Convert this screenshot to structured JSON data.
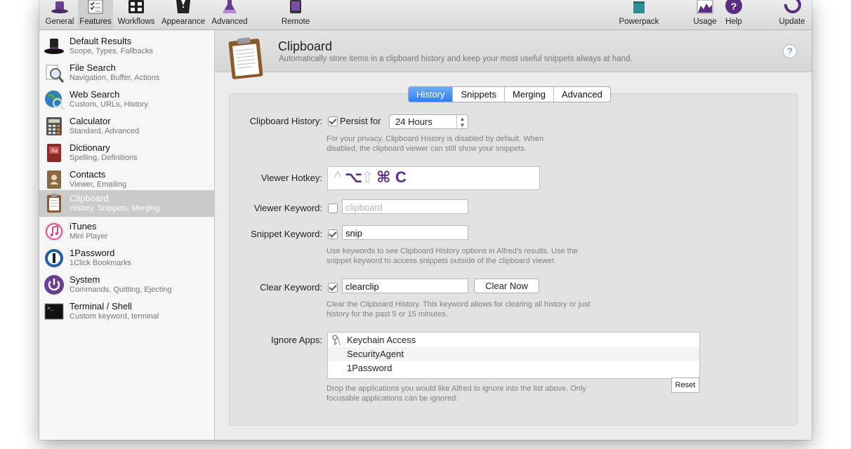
{
  "toolbar": {
    "items": [
      {
        "label": "General",
        "icon": "hat-icon"
      },
      {
        "label": "Features",
        "icon": "checklist-icon"
      },
      {
        "label": "Workflows",
        "icon": "workflows-grid-icon"
      },
      {
        "label": "Appearance",
        "icon": "tuxedo-icon"
      },
      {
        "label": "Advanced",
        "icon": "flask-icon"
      },
      {
        "label": "Remote",
        "icon": "ipad-icon"
      },
      {
        "label": "Powerpack",
        "icon": "powerpack-icon"
      },
      {
        "label": "Usage",
        "icon": "usage-chart-icon"
      },
      {
        "label": "Help",
        "icon": "help-icon"
      },
      {
        "label": "Update",
        "icon": "update-icon"
      }
    ],
    "active": "Features"
  },
  "sidebar": {
    "items": [
      {
        "title": "Default Results",
        "subtitle": "Scope, Types, Fallbacks"
      },
      {
        "title": "File Search",
        "subtitle": "Navigation, Buffer, Actions"
      },
      {
        "title": "Web Search",
        "subtitle": "Custom, URLs, History"
      },
      {
        "title": "Calculator",
        "subtitle": "Standard, Advanced"
      },
      {
        "title": "Dictionary",
        "subtitle": "Spelling, Definitions"
      },
      {
        "title": "Contacts",
        "subtitle": "Viewer, Emailing"
      },
      {
        "title": "Clipboard",
        "subtitle": "History, Snippets, Merging"
      },
      {
        "title": "iTunes",
        "subtitle": "Mini Player"
      },
      {
        "title": "1Password",
        "subtitle": "1Click Bookmarks"
      },
      {
        "title": "System",
        "subtitle": "Commands, Quitting, Ejecting"
      },
      {
        "title": "Terminal / Shell",
        "subtitle": "Custom keyword, terminal"
      }
    ],
    "selected": "Clipboard"
  },
  "header": {
    "title": "Clipboard",
    "subtitle": "Automatically store items in a clipboard history and keep your most useful snippets always at hand.",
    "help": "?"
  },
  "tabs": [
    "History",
    "Snippets",
    "Merging",
    "Advanced"
  ],
  "active_tab": "History",
  "form": {
    "clipboard_history_label": "Clipboard History:",
    "persist_label": "Persist for",
    "persist_checked": true,
    "persist_value": "24 Hours",
    "privacy_help": "For your privacy, Clipboard History is disabled by default. When disabled, the clipboard viewer can still show your snippets.",
    "viewer_hotkey_label": "Viewer Hotkey:",
    "hotkey": {
      "ctrl": "^",
      "opt": "⌥",
      "shift": "⇧",
      "cmd": "⌘",
      "key": "C"
    },
    "viewer_keyword_label": "Viewer Keyword:",
    "viewer_keyword_checked": false,
    "viewer_keyword_placeholder": "clipboard",
    "snippet_keyword_label": "Snippet Keyword:",
    "snippet_keyword_checked": true,
    "snippet_keyword_value": "snip",
    "snippet_help": "Use keywords to see Clipboard History options in Alfred's results. Use the snippet keyword to access snippets outside of the clipboard viewer.",
    "clear_keyword_label": "Clear Keyword:",
    "clear_keyword_checked": true,
    "clear_keyword_value": "clearclip",
    "clear_now_label": "Clear Now",
    "clear_help": "Clear the Clipboard History. This keyword allows for clearing all history or just history for the past 5 or 15 minutes.",
    "ignore_apps_label": "Ignore Apps:",
    "ignore_apps": [
      "Keychain Access",
      "SecurityAgent",
      "1Password"
    ],
    "reset_label": "Reset",
    "ignore_help": "Drop the applications you would like Alfred to ignore into the list above. Only focusable applications can be ignored."
  }
}
